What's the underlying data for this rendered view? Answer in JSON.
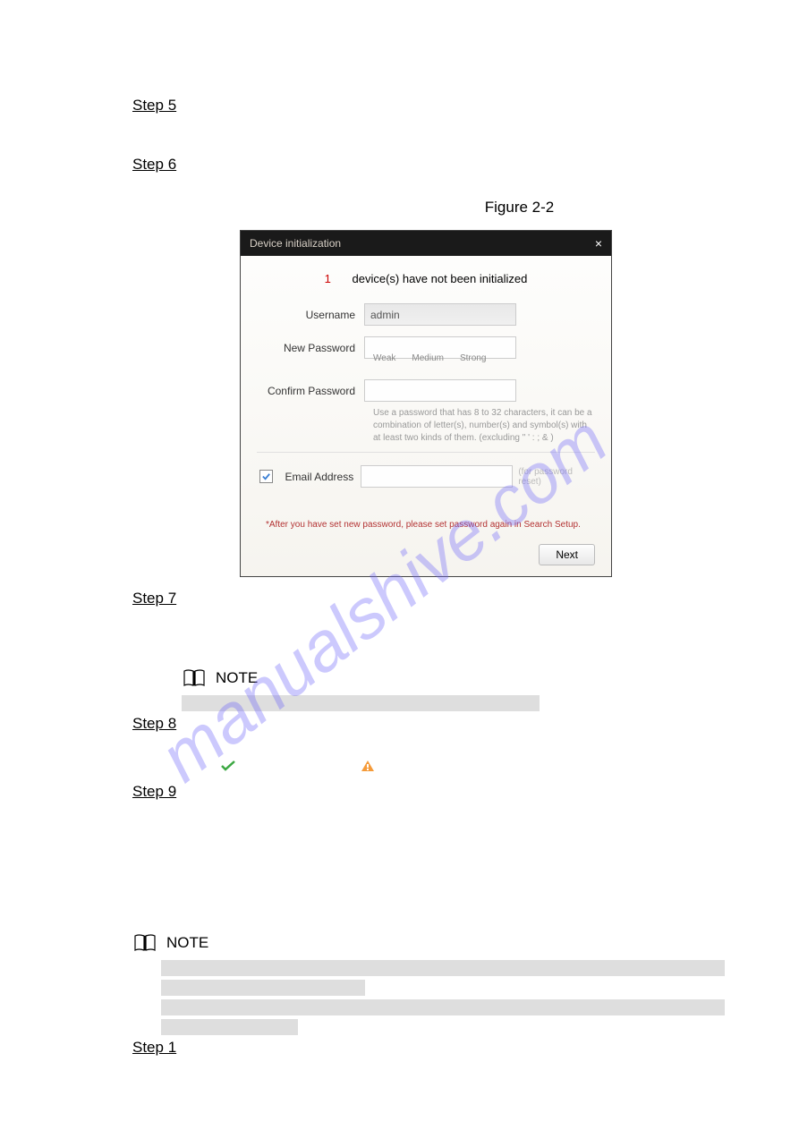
{
  "steps": {
    "s5": "Step 5",
    "s6": "Step 6",
    "s7": "Step 7",
    "s8": "Step 8",
    "s9": "Step 9",
    "s1": "Step 1"
  },
  "figureLabel": "Figure 2-2",
  "dialog": {
    "title": "Device initialization",
    "count": "1",
    "message": "device(s) have not been initialized",
    "usernameLabel": "Username",
    "usernameValue": "admin",
    "newPasswordLabel": "New Password",
    "strength": {
      "weak": "Weak",
      "medium": "Medium",
      "strong": "Strong"
    },
    "confirmLabel": "Confirm Password",
    "helper": "Use a password that has 8 to 32 characters, it can be a combination of letter(s), number(s) and symbol(s) with at least two kinds of them. (excluding \" ' : ; & )",
    "emailLabel": "Email Address",
    "emailHint": "(for password reset)",
    "warning": "*After you have set new password, please set password again in Search Setup.",
    "nextButton": "Next"
  },
  "noteLabel": "NOTE"
}
